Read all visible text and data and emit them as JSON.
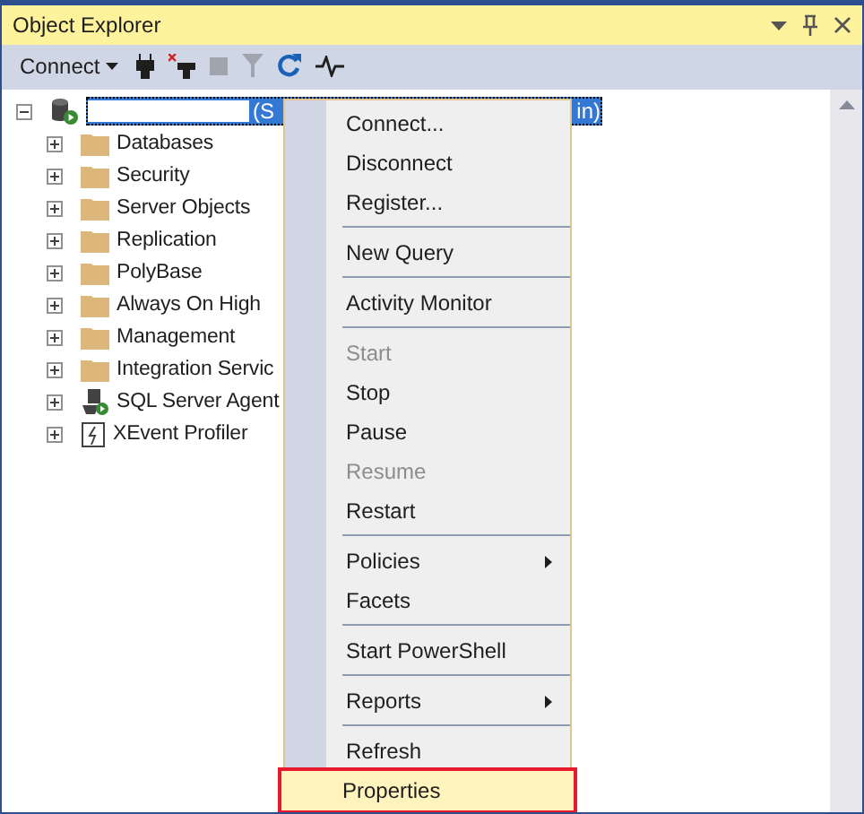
{
  "window": {
    "title": "Object Explorer"
  },
  "toolbar": {
    "connect_label": "Connect"
  },
  "server": {
    "label_start": "(S",
    "label_end": "in)",
    "expanded": true,
    "selected": true
  },
  "tree": [
    {
      "label": "Databases",
      "kind": "folder"
    },
    {
      "label": "Security",
      "kind": "folder"
    },
    {
      "label": "Server Objects",
      "kind": "folder"
    },
    {
      "label": "Replication",
      "kind": "folder"
    },
    {
      "label": "PolyBase",
      "kind": "folder"
    },
    {
      "label": "Always On High",
      "kind": "folder"
    },
    {
      "label": "Management",
      "kind": "folder"
    },
    {
      "label": "Integration Servic",
      "kind": "folder"
    },
    {
      "label": "SQL Server Agent",
      "kind": "agent"
    },
    {
      "label": "XEvent Profiler",
      "kind": "profiler"
    }
  ],
  "context_menu": [
    {
      "kind": "item",
      "label": "Connect...",
      "disabled": false,
      "submenu": false,
      "selected": false
    },
    {
      "kind": "item",
      "label": "Disconnect",
      "disabled": false,
      "submenu": false,
      "selected": false
    },
    {
      "kind": "item",
      "label": "Register...",
      "disabled": false,
      "submenu": false,
      "selected": false
    },
    {
      "kind": "separator"
    },
    {
      "kind": "item",
      "label": "New Query",
      "disabled": false,
      "submenu": false,
      "selected": false
    },
    {
      "kind": "separator"
    },
    {
      "kind": "item",
      "label": "Activity Monitor",
      "disabled": false,
      "submenu": false,
      "selected": false
    },
    {
      "kind": "separator"
    },
    {
      "kind": "item",
      "label": "Start",
      "disabled": true,
      "submenu": false,
      "selected": false
    },
    {
      "kind": "item",
      "label": "Stop",
      "disabled": false,
      "submenu": false,
      "selected": false
    },
    {
      "kind": "item",
      "label": "Pause",
      "disabled": false,
      "submenu": false,
      "selected": false
    },
    {
      "kind": "item",
      "label": "Resume",
      "disabled": true,
      "submenu": false,
      "selected": false
    },
    {
      "kind": "item",
      "label": "Restart",
      "disabled": false,
      "submenu": false,
      "selected": false
    },
    {
      "kind": "separator"
    },
    {
      "kind": "item",
      "label": "Policies",
      "disabled": false,
      "submenu": true,
      "selected": false
    },
    {
      "kind": "item",
      "label": "Facets",
      "disabled": false,
      "submenu": false,
      "selected": false
    },
    {
      "kind": "separator"
    },
    {
      "kind": "item",
      "label": "Start PowerShell",
      "disabled": false,
      "submenu": false,
      "selected": false
    },
    {
      "kind": "separator"
    },
    {
      "kind": "item",
      "label": "Reports",
      "disabled": false,
      "submenu": true,
      "selected": false
    },
    {
      "kind": "separator"
    },
    {
      "kind": "item",
      "label": "Refresh",
      "disabled": false,
      "submenu": false,
      "selected": false
    },
    {
      "kind": "item",
      "label": "Properties",
      "disabled": false,
      "submenu": false,
      "selected": true
    }
  ]
}
